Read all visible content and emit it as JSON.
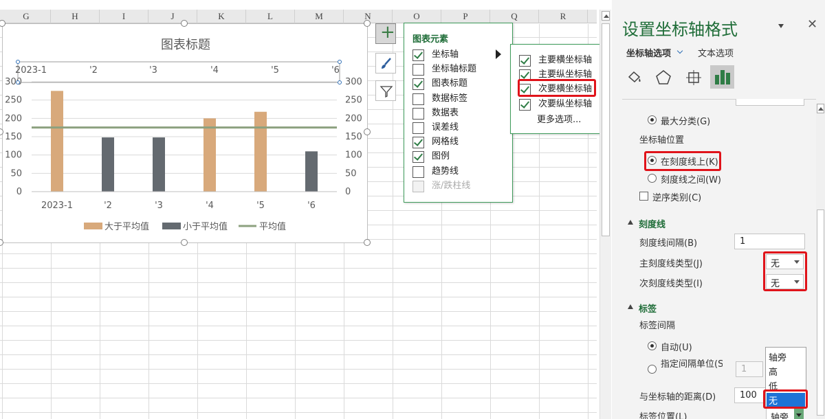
{
  "sheet": {
    "columns": [
      "G",
      "H",
      "I",
      "J",
      "K",
      "L",
      "M",
      "N",
      "O",
      "P",
      "Q",
      "R"
    ]
  },
  "chart": {
    "title": "图表标题",
    "chart_data": {
      "type": "bar",
      "categories": [
        "2023-1",
        "'2",
        "'3",
        "'4",
        "'5",
        "'6"
      ],
      "series": [
        {
          "name": "大于平均值",
          "values": [
            275,
            null,
            null,
            200,
            218,
            null
          ],
          "color": "#d8a97b"
        },
        {
          "name": "小于平均值",
          "values": [
            null,
            148,
            148,
            null,
            null,
            110
          ],
          "color": "#646a70"
        },
        {
          "name": "平均值",
          "type": "line",
          "values": [
            175,
            175,
            175,
            175,
            175,
            175
          ],
          "color": "#8ca17f"
        }
      ],
      "ylim": [
        0,
        300
      ],
      "yticks": [
        "300",
        "250",
        "200",
        "150",
        "100",
        "50",
        "0"
      ],
      "secondary_yticks": [
        "300",
        "250",
        "200",
        "150",
        "100",
        "50",
        "0"
      ],
      "secondary_x_labels": [
        "2023-1",
        "'2",
        "'3",
        "'4",
        "'5",
        "'6"
      ],
      "grid": true,
      "legend": "bottom"
    }
  },
  "chart_buttons": {
    "add": "plus-icon",
    "style": "brush-icon",
    "filter": "filter-icon"
  },
  "elements_popup": {
    "title": "图表元素",
    "items": [
      {
        "label": "坐标轴",
        "checked": true
      },
      {
        "label": "坐标轴标题",
        "checked": false
      },
      {
        "label": "图表标题",
        "checked": true
      },
      {
        "label": "数据标签",
        "checked": false
      },
      {
        "label": "数据表",
        "checked": false
      },
      {
        "label": "误差线",
        "checked": false
      },
      {
        "label": "网格线",
        "checked": true
      },
      {
        "label": "图例",
        "checked": true
      },
      {
        "label": "趋势线",
        "checked": false
      },
      {
        "label": "涨/跌柱线",
        "checked": false,
        "disabled": true
      }
    ]
  },
  "axis_popup": {
    "items": [
      {
        "label": "主要横坐标轴",
        "checked": true
      },
      {
        "label": "主要纵坐标轴",
        "checked": true
      },
      {
        "label": "次要横坐标轴",
        "checked": true
      },
      {
        "label": "次要纵坐标轴",
        "checked": true
      }
    ],
    "more": "更多选项..."
  },
  "pane": {
    "title": "设置坐标轴格式",
    "tab_axis_options": "坐标轴选项",
    "tab_text_options": "文本选项",
    "max_category": "最大分类(G)",
    "axis_position": "坐标轴位置",
    "on_tick_marks": "在刻度线上(K)",
    "between_tick_marks": "刻度线之间(W)",
    "reverse_order": "逆序类别(C)",
    "tick_marks_section": "刻度线",
    "tick_interval_label": "刻度线间隔(B)",
    "tick_interval_value": "1",
    "major_tick_label": "主刻度线类型(J)",
    "major_tick_value": "无",
    "minor_tick_label": "次刻度线类型(I)",
    "minor_tick_value": "无",
    "labels_section": "标签",
    "label_interval": "标签间隔",
    "auto": "自动(U)",
    "specify_interval": "指定间隔单位(S)",
    "specify_interval_value": "1",
    "distance_label": "与坐标轴的距离(D)",
    "distance_value": "100",
    "label_position_label": "标签位置(L)",
    "label_position_value": "轴旁",
    "dropdown_options": [
      "轴旁",
      "高",
      "低",
      "无"
    ],
    "dropdown_selected": "无"
  }
}
